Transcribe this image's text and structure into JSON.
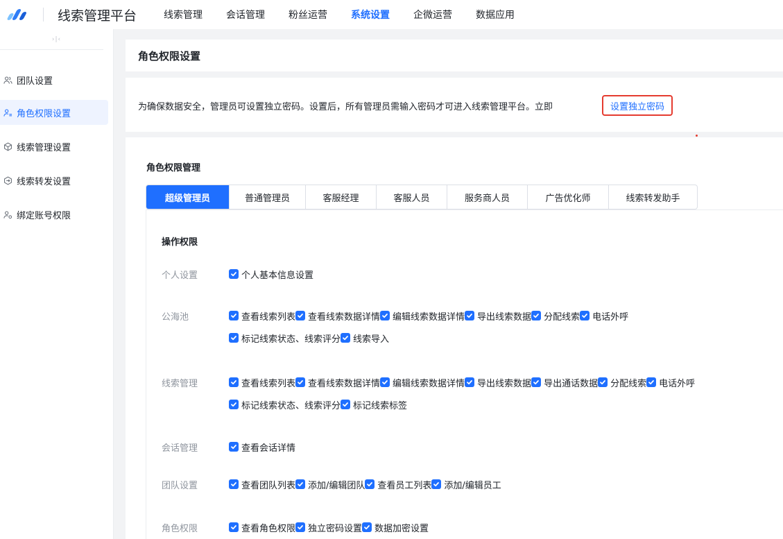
{
  "brand": {
    "title": "线索管理平台"
  },
  "nav": [
    {
      "label": "线索管理",
      "active": false
    },
    {
      "label": "会话管理",
      "active": false
    },
    {
      "label": "粉丝运营",
      "active": false
    },
    {
      "label": "系统设置",
      "active": true
    },
    {
      "label": "企微运营",
      "active": false
    },
    {
      "label": "数据应用",
      "active": false
    }
  ],
  "sidebar": {
    "items": [
      {
        "label": "团队设置",
        "icon": "team-icon",
        "active": false
      },
      {
        "label": "角色权限设置",
        "icon": "role-icon",
        "active": true
      },
      {
        "label": "线索管理设置",
        "icon": "cube-icon",
        "active": false
      },
      {
        "label": "线索转发设置",
        "icon": "forward-icon",
        "active": false
      },
      {
        "label": "绑定账号权限",
        "icon": "bind-user-icon",
        "active": false
      }
    ]
  },
  "page": {
    "title": "角色权限设置"
  },
  "notice": {
    "text": "为确保数据安全，管理员可设置独立密码。设置后，所有管理员需输入密码才可进入线索管理平台。立即",
    "link": "设置独立密码"
  },
  "role_section": {
    "title": "角色权限管理",
    "tabs": [
      {
        "label": "超级管理员",
        "active": true
      },
      {
        "label": "普通管理员",
        "active": false
      },
      {
        "label": "客服经理",
        "active": false
      },
      {
        "label": "客服人员",
        "active": false
      },
      {
        "label": "服务商人员",
        "active": false
      },
      {
        "label": "广告优化师",
        "active": false
      },
      {
        "label": "线索转发助手",
        "active": false
      }
    ],
    "perm_title": "操作权限",
    "groups": [
      {
        "label": "个人设置",
        "lines": [
          [
            "个人基本信息设置"
          ]
        ]
      },
      {
        "label": "公海池",
        "lines": [
          [
            "查看线索列表",
            "查看线索数据详情",
            "编辑线索数据详情",
            "导出线索数据",
            "分配线索",
            "电话外呼"
          ],
          [
            "标记线索状态、线索评分",
            "线索导入"
          ]
        ]
      },
      {
        "label": "线索管理",
        "lines": [
          [
            "查看线索列表",
            "查看线索数据详情",
            "编辑线索数据详情",
            "导出线索数据",
            "导出通话数据",
            "分配线索",
            "电话外呼"
          ],
          [
            "标记线索状态、线索评分",
            "标记线索标签"
          ]
        ]
      },
      {
        "label": "会话管理",
        "lines": [
          [
            "查看会话详情"
          ]
        ]
      },
      {
        "label": "团队设置",
        "lines": [
          [
            "查看团队列表",
            "添加/编辑团队",
            "查看员工列表",
            "添加/编辑员工"
          ]
        ]
      },
      {
        "label": "角色权限",
        "lines": [
          [
            "查看角色权限",
            "独立密码设置",
            "数据加密设置"
          ]
        ]
      }
    ]
  },
  "colors": {
    "accent": "#1f6fff",
    "highlight_border": "#e53b2f"
  }
}
